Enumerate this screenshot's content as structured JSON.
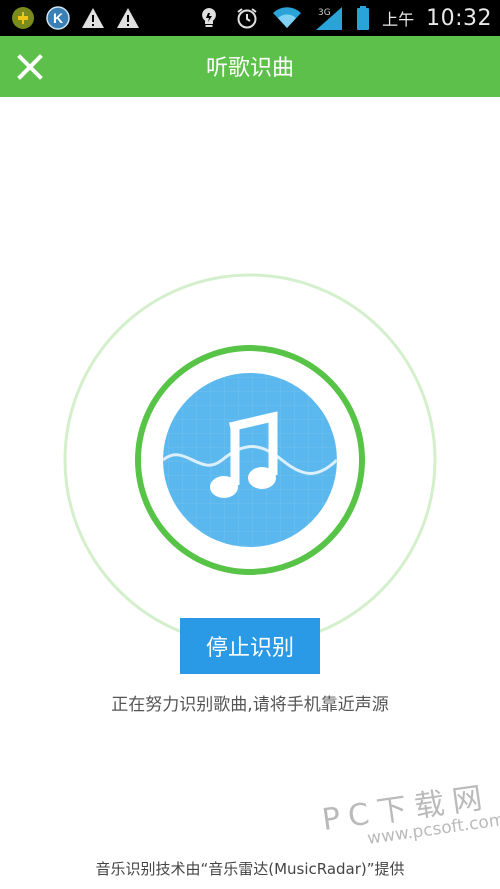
{
  "status_bar": {
    "ampm": "上午",
    "time": "10:32",
    "network": "3G",
    "icons": [
      "puzzle-app-icon",
      "k-app-icon",
      "warning-icon",
      "warning-icon",
      "bulb-icon",
      "alarm-icon",
      "wifi-icon",
      "signal-icon",
      "battery-icon"
    ]
  },
  "header": {
    "title": "听歌识曲",
    "close_icon": "close-icon"
  },
  "radar": {
    "center_icon": "music-note-icon",
    "colors": {
      "outer_ring": "#cfedc6",
      "inner_ring": "#58c447",
      "disc": "#5bb8ee",
      "wave": "#d6ecfb"
    }
  },
  "stop_button": {
    "label": "停止识别"
  },
  "hint": "正在努力识别歌曲,请将手机靠近声源",
  "footer": {
    "credit": "音乐识别技术由“音乐雷达(MusicRadar)”提供"
  },
  "watermark": {
    "main": "PC下载网",
    "sub": "www.pcsoft.com.cn"
  },
  "colors": {
    "accent_green": "#5dc04a",
    "button_blue": "#2b9ae6"
  }
}
